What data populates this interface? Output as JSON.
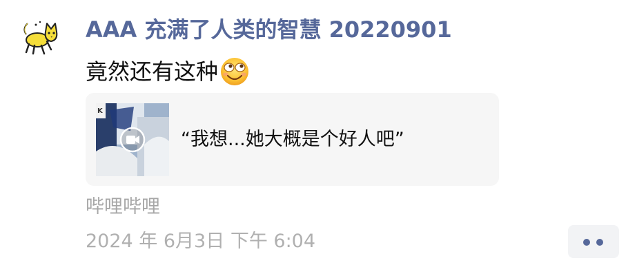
{
  "post": {
    "author": "AAA 充满了人类的智慧 20220901",
    "text": "竟然还有这种",
    "emoji": "grinning-squinting-face",
    "shared_link": {
      "title": "“我想...她大概是个好人吧”",
      "media_type": "video",
      "play_icon": "video-camera-icon"
    },
    "source": "哔哩哔哩",
    "timestamp": "2024 年 6月3日 下午 6:04"
  },
  "colors": {
    "author_name": "#56689a",
    "body_text": "#111111",
    "muted_text": "#a7a7a7",
    "card_background": "#f6f6f6",
    "more_button_background": "#f2f3f5",
    "more_button_dots": "#56689a"
  },
  "more_button": {
    "icon": "more-dots-icon"
  }
}
